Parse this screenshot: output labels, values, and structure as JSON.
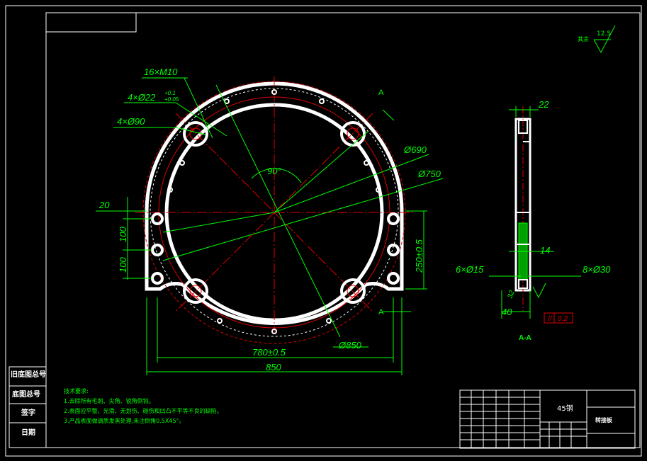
{
  "dims": {
    "holes_m10": "16×M10",
    "holes_d22": "4×Ø22",
    "tol_upper": "+0.1",
    "tol_lower": "+0.05",
    "holes_d90": "4×Ø90",
    "d690": "Ø690",
    "d750": "Ø750",
    "d850": "Ø850",
    "angle": "90°",
    "edge20": "20",
    "pitch100a": "100",
    "pitch100b": "100",
    "h250": "250±0.5",
    "w780": "780±0.5",
    "w850": "850",
    "section_mark": "A",
    "t22": "22",
    "t14": "14",
    "h6": "6×Ø15",
    "h8": "8×Ø30",
    "t40": "40",
    "t32": "32",
    "flat": "0.2",
    "section_label": "A-A"
  },
  "roughness": {
    "label": "其余",
    "value": "12.5"
  },
  "side_labels": [
    "旧底图总号",
    "底图总号",
    "签字",
    "日期"
  ],
  "notes": {
    "title": "技术要求:",
    "items": [
      "1.去除所有毛刺、尖角、锐角倒钝。",
      "2.表面应平整、光滑、无划伤、碰伤和凹凸不平等不良的缺陷。",
      "3.产品表面做调质发黑处理,未注倒角0.5X45°。"
    ]
  },
  "titleblock": {
    "material": "45钢",
    "part": "转接板"
  }
}
